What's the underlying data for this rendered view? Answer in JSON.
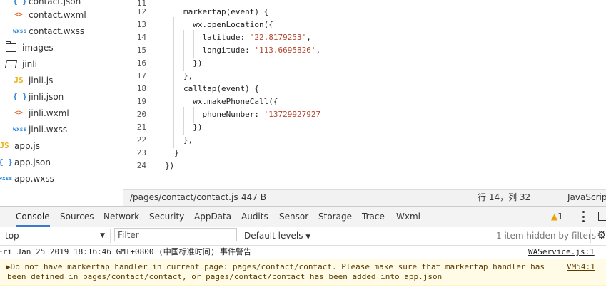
{
  "file_tree": {
    "items": [
      {
        "icon": "json-icon",
        "glyph": "{ }",
        "label": "contact.json"
      },
      {
        "icon": "wxml-icon",
        "glyph": "<>",
        "label": "contact.wxml"
      },
      {
        "icon": "wxss-icon",
        "glyph": "wxss",
        "label": "contact.wxss"
      },
      {
        "icon": "folder-icon",
        "glyph": "",
        "label": "images"
      },
      {
        "icon": "folder-open-icon",
        "glyph": "",
        "label": "jinli"
      },
      {
        "icon": "js-icon",
        "glyph": "JS",
        "label": "jinli.js"
      },
      {
        "icon": "json-icon",
        "glyph": "{ }",
        "label": "jinli.json"
      },
      {
        "icon": "wxml-icon",
        "glyph": "<>",
        "label": "jinli.wxml"
      },
      {
        "icon": "wxss-icon",
        "glyph": "wxss",
        "label": "jinli.wxss"
      },
      {
        "icon": "js-icon",
        "glyph": "JS",
        "label": "app.js"
      },
      {
        "icon": "json-icon",
        "glyph": "{ }",
        "label": "app.json"
      },
      {
        "icon": "wxss-icon",
        "glyph": "wxss",
        "label": "app.wxss"
      }
    ]
  },
  "editor": {
    "lines": [
      {
        "num": "11",
        "code": ""
      },
      {
        "num": "12",
        "code": "markertap(event) {"
      },
      {
        "num": "13",
        "code": "  wx.openLocation({"
      },
      {
        "num": "14",
        "code": "    latitude: ",
        "str": "'22.8179253'",
        "tail": ","
      },
      {
        "num": "15",
        "code": "    longitude: ",
        "str": "'113.6695826'",
        "tail": ","
      },
      {
        "num": "16",
        "code": "  })"
      },
      {
        "num": "17",
        "code": "},"
      },
      {
        "num": "18",
        "code": "calltap(event) {"
      },
      {
        "num": "19",
        "code": "  wx.makePhoneCall({"
      },
      {
        "num": "20",
        "code": "    phoneNumber: ",
        "str": "'13729927927'",
        "tail": ""
      },
      {
        "num": "21",
        "code": "  })"
      },
      {
        "num": "22",
        "code": "},"
      },
      {
        "num": "23",
        "code": "}"
      },
      {
        "num": "24",
        "code": "})"
      }
    ]
  },
  "statusbar": {
    "path": "/pages/contact/contact.js",
    "size": "447 B",
    "cursor": "行 14，列 32",
    "language": "JavaScript"
  },
  "devtools": {
    "tabs": [
      "Console",
      "Sources",
      "Network",
      "Security",
      "AppData",
      "Audits",
      "Sensor",
      "Storage",
      "Trace",
      "Wxml"
    ],
    "active_tab": "Console",
    "warning_count": "1"
  },
  "filterbar": {
    "context": "top",
    "filter_placeholder": "Filter",
    "levels": "Default levels",
    "hidden_info": "1 item hidden by filters"
  },
  "console": {
    "messages": [
      {
        "text": "Fri Jan 25 2019 18:16:46 GMT+0800 (中国标准时间) 事件警告",
        "source": "WAService.js:1"
      },
      {
        "line1": "▶Do not have markertap handler in current page: pages/contact/contact. Please make sure that markertap handler has",
        "line2": "been defined in pages/contact/contact, or pages/contact/contact has been added into app.json",
        "source": "VM54:1"
      }
    ]
  },
  "colors": {
    "accent": "#3a78d4",
    "string": "#b5462e",
    "warning_bg": "#fffbe6",
    "warning_icon": "#e8a400"
  }
}
